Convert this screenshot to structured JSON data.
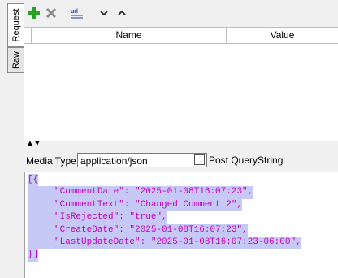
{
  "tabs": [
    {
      "label": "Request",
      "active": true
    },
    {
      "label": "Raw",
      "active": false
    }
  ],
  "toolbar": {
    "buttons": [
      {
        "name": "add-param-button",
        "icon": "plus-icon",
        "color": "#2aa02a"
      },
      {
        "name": "delete-param-button",
        "icon": "x-icon",
        "color": "#8a8a8a"
      },
      {
        "name": "url-encode-button",
        "icon": "url-encode-icon",
        "glyph": "url"
      },
      {
        "name": "move-down-button",
        "icon": "chevron-down-icon"
      },
      {
        "name": "move-up-button",
        "icon": "chevron-up-icon"
      }
    ]
  },
  "grid": {
    "columns": [
      "Name",
      "Value"
    ]
  },
  "media": {
    "label": "Media Type",
    "value": "application/json",
    "post_querystring_label": "Post QueryString",
    "post_querystring_checked": false
  },
  "body": {
    "lines": [
      "[{",
      "     \"CommentDate\": \"2025-01-08T16:07:23\",",
      "     \"CommentText\": \"Changed Comment 2\",",
      "     \"IsRejected\": \"true\",",
      "     \"CreateDate\": \"2025-01-08T16:07:23\",",
      "     \"LastUpdateDate\": \"2025-01-08T16:07:23-06:00\",",
      "}]"
    ],
    "text_color": "#c000c0",
    "selection_color": "#c6c9f5"
  }
}
